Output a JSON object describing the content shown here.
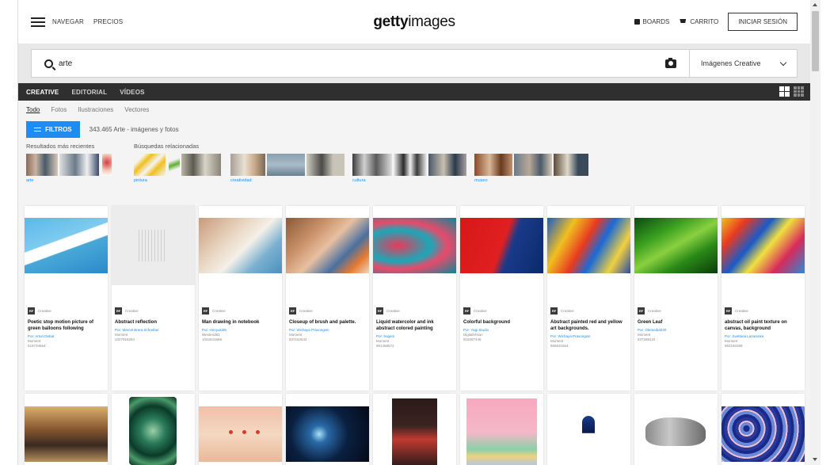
{
  "header": {
    "navigate_label": "NAVEGAR",
    "prices_label": "PRECIOS",
    "logo_bold": "getty",
    "logo_light": "images",
    "boards_label": "BOARDS",
    "cart_label": "CARRITO",
    "login_label": "INICIAR SESIÓN"
  },
  "search": {
    "value": "arte",
    "type_select": "Imágenes Creative"
  },
  "tabs": [
    "CREATIVE",
    "EDITORIAL",
    "VÍDEOS"
  ],
  "active_tab": 0,
  "subtabs": [
    "Todo",
    "Fotos",
    "Ilustraciones",
    "Vectores"
  ],
  "filter_label": "FILTROS",
  "result_count": "343.465 Arte - imágenes y fotos",
  "related": {
    "recent_label": "Resultados más recientes",
    "related_label": "Búsquedas relacionadas",
    "captions": [
      "arte",
      "pintura",
      "creatividad",
      "cultura",
      "museo"
    ]
  },
  "cards": [
    {
      "badge": "Creative",
      "title": "Poetic stop motion picture of green balloons following",
      "author": "Por: Arturi Debat",
      "collection": "Moment",
      "id": "519734664"
    },
    {
      "badge": "Creative",
      "title": "Abstract reflection",
      "author": "Por: Marcel Brera Schreiber",
      "collection": "Moment",
      "id": "1027918264"
    },
    {
      "badge": "Creative",
      "title": "Man drawing in notebook",
      "author": "Por: Hiroyuki09",
      "collection": "Westend61",
      "id": "1042641668"
    },
    {
      "badge": "Creative",
      "title": "Closeup of brush and palette.",
      "author": "Por: Wichaya Prasongsin",
      "collection": "Moment",
      "id": "637152544"
    },
    {
      "badge": "Creative",
      "title": "Liquid watercolor and ink abstract colored painting",
      "author": "Por: bogem",
      "collection": "Moment",
      "id": "951468572"
    },
    {
      "badge": "Creative",
      "title": "Colorful background",
      "author": "Por: Yagi Studio",
      "collection": "DigitalVision",
      "id": "918287446"
    },
    {
      "badge": "Creative",
      "title": "Abstract painted red and yellow art backgrounds.",
      "author": "Por: Wichaya Prasongsin",
      "collection": "Moment",
      "id": "966531564"
    },
    {
      "badge": "Creative",
      "title": "Green Leaf",
      "author": "Por: Olemedia030",
      "collection": "Moment",
      "id": "637269134"
    },
    {
      "badge": "Creative",
      "title": "abstract oil paint texture on canvas, background",
      "author": "Por: Svetlana Lazarenka",
      "collection": "Moment",
      "id": "862150288"
    }
  ],
  "colors": {
    "accent": "#1e8cf0",
    "dark_bar": "#2f2f2f",
    "page_bg": "#f4f4f4"
  }
}
